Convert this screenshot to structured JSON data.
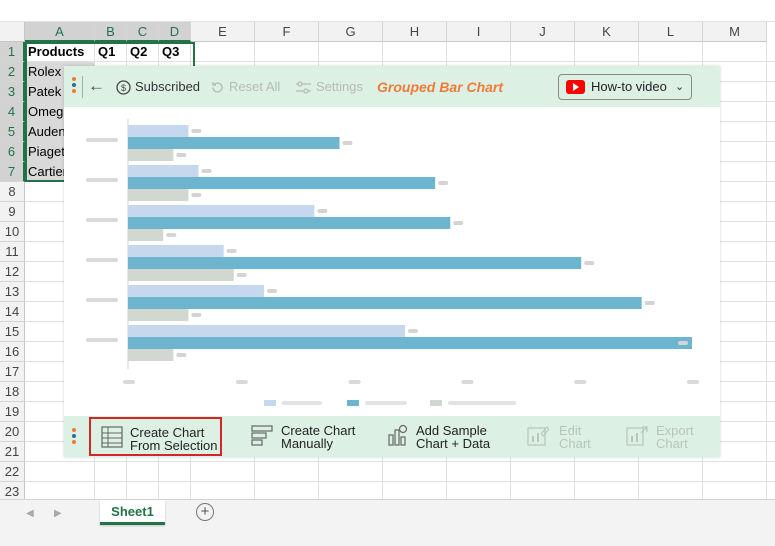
{
  "spreadsheet": {
    "columns": [
      "A",
      "B",
      "C",
      "D",
      "E",
      "F",
      "G",
      "H",
      "I",
      "J",
      "K",
      "L",
      "M"
    ],
    "rows": [
      "1",
      "2",
      "3",
      "4",
      "5",
      "6",
      "7",
      "8",
      "9",
      "10",
      "11",
      "12",
      "13",
      "14",
      "15",
      "16",
      "17",
      "18",
      "19",
      "20",
      "21",
      "22",
      "23"
    ],
    "cells": {
      "A1": "Products",
      "B1": "Q1",
      "C1": "Q2",
      "D1": "Q3",
      "A2": "Rolex",
      "A3": "Patek",
      "A4": "Omega",
      "A5": "Auden",
      "A6": "Piaget",
      "A7": "Cartier"
    },
    "sheet_tab": "Sheet1",
    "add_sheet": "+"
  },
  "panel": {
    "subscribed": "Subscribed",
    "reset_all": "Reset All",
    "settings": "Settings",
    "title": "Grouped Bar Chart",
    "howto": "How-to video",
    "accent": "#ef7b39",
    "bottom": {
      "create_selection": "Create Chart\nFrom Selection",
      "create_manual": "Create Chart\nManually",
      "add_sample": "Add Sample\nChart + Data",
      "edit_chart": "Edit\nChart",
      "export_chart": "Export\nChart"
    }
  },
  "chart_data": {
    "type": "bar",
    "orientation": "horizontal",
    "categories": [
      "",
      "",
      "",
      "",
      "",
      ""
    ],
    "series": [
      {
        "color": "#c5d8ee",
        "values": [
          12,
          14,
          37,
          19,
          27,
          55
        ]
      },
      {
        "color": "#6db4cf",
        "values": [
          42,
          61,
          64,
          90,
          102,
          112
        ]
      },
      {
        "color": "#d1d8cf",
        "values": [
          9,
          12,
          7,
          21,
          12,
          9
        ]
      }
    ],
    "xlim": [
      0,
      112
    ],
    "note": "placeholder chart: labels rendered as grey blocks"
  }
}
